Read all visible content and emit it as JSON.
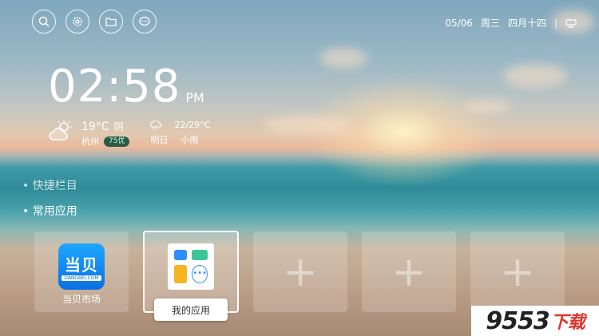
{
  "top_icons": [
    {
      "name": "search-icon"
    },
    {
      "name": "gear-icon"
    },
    {
      "name": "folder-icon"
    },
    {
      "name": "chat-icon"
    }
  ],
  "status": {
    "date": "05/06",
    "weekday": "周三",
    "lunar": "四月十四",
    "separator": "|"
  },
  "clock": {
    "time": "02:58",
    "ampm": "PM"
  },
  "weather": {
    "today_temp": "19°C",
    "today_condition": "阴",
    "city": "杭州",
    "aqi": "75优",
    "tomorrow_range": "22/29°C",
    "tomorrow_label": "明日",
    "tomorrow_condition": "小雨"
  },
  "menu": {
    "items": [
      "• 快捷栏目",
      "• 常用应用"
    ]
  },
  "tiles": {
    "dangbei": {
      "logo_text": "当贝",
      "logo_sub": "DANGBEI.COM",
      "label": "当贝市场"
    },
    "myapps": {
      "label": "我的应用"
    },
    "plus_symbol": "+"
  },
  "watermark": {
    "main": "9553",
    "suffix": "下载"
  }
}
